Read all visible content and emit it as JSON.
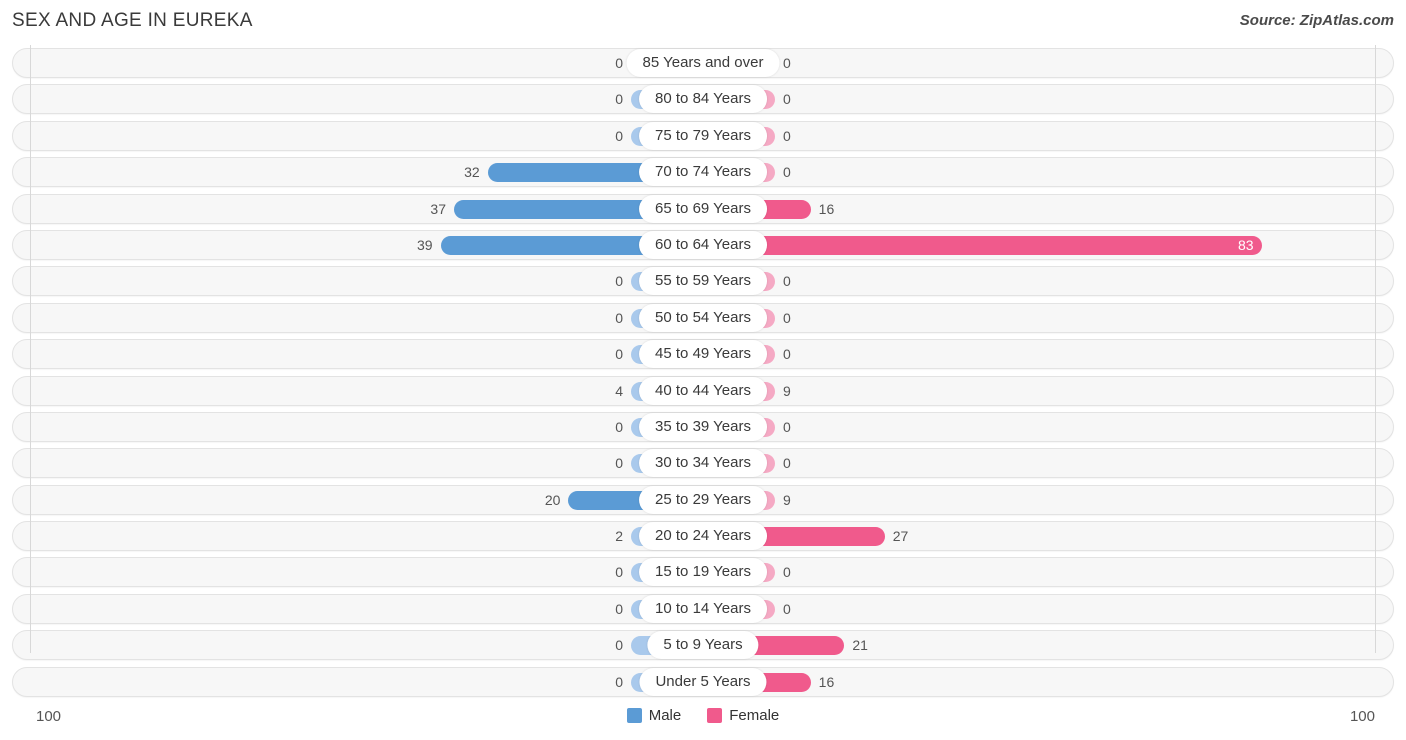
{
  "header": {
    "title": "SEX AND AGE IN EUREKA",
    "source": "Source: ZipAtlas.com"
  },
  "legend": {
    "male_label": "Male",
    "female_label": "Female",
    "male_color": "#5b9bd5",
    "female_color": "#f05a8c"
  },
  "axis": {
    "left_label": "100",
    "right_label": "100"
  },
  "chart_data": {
    "type": "bar",
    "subtype": "population-pyramid",
    "title": "SEX AND AGE IN EUREKA",
    "xlabel": "",
    "ylabel": "",
    "xlim": [
      0,
      100
    ],
    "grid": true,
    "legend_position": "bottom-center",
    "categories": [
      "85 Years and over",
      "80 to 84 Years",
      "75 to 79 Years",
      "70 to 74 Years",
      "65 to 69 Years",
      "60 to 64 Years",
      "55 to 59 Years",
      "50 to 54 Years",
      "45 to 49 Years",
      "40 to 44 Years",
      "35 to 39 Years",
      "30 to 34 Years",
      "25 to 29 Years",
      "20 to 24 Years",
      "15 to 19 Years",
      "10 to 14 Years",
      "5 to 9 Years",
      "Under 5 Years"
    ],
    "series": [
      {
        "name": "Male",
        "color": "#5b9bd5",
        "values": [
          0,
          0,
          0,
          32,
          37,
          39,
          0,
          0,
          0,
          4,
          0,
          0,
          20,
          2,
          0,
          0,
          0,
          0
        ]
      },
      {
        "name": "Female",
        "color": "#f05a8c",
        "values": [
          0,
          0,
          0,
          0,
          16,
          83,
          0,
          0,
          0,
          9,
          0,
          0,
          9,
          27,
          0,
          0,
          21,
          16
        ]
      }
    ]
  },
  "rows": [
    {
      "age": "85 Years and over",
      "male": "0",
      "female": "0"
    },
    {
      "age": "80 to 84 Years",
      "male": "0",
      "female": "0"
    },
    {
      "age": "75 to 79 Years",
      "male": "0",
      "female": "0"
    },
    {
      "age": "70 to 74 Years",
      "male": "32",
      "female": "0"
    },
    {
      "age": "65 to 69 Years",
      "male": "37",
      "female": "16"
    },
    {
      "age": "60 to 64 Years",
      "male": "39",
      "female": "83"
    },
    {
      "age": "55 to 59 Years",
      "male": "0",
      "female": "0"
    },
    {
      "age": "50 to 54 Years",
      "male": "0",
      "female": "0"
    },
    {
      "age": "45 to 49 Years",
      "male": "0",
      "female": "0"
    },
    {
      "age": "40 to 44 Years",
      "male": "4",
      "female": "9"
    },
    {
      "age": "35 to 39 Years",
      "male": "0",
      "female": "0"
    },
    {
      "age": "30 to 34 Years",
      "male": "0",
      "female": "0"
    },
    {
      "age": "25 to 29 Years",
      "male": "20",
      "female": "9"
    },
    {
      "age": "20 to 24 Years",
      "male": "2",
      "female": "27"
    },
    {
      "age": "15 to 19 Years",
      "male": "0",
      "female": "0"
    },
    {
      "age": "10 to 14 Years",
      "male": "0",
      "female": "0"
    },
    {
      "age": "5 to 9 Years",
      "male": "0",
      "female": "21"
    },
    {
      "age": "Under 5 Years",
      "male": "0",
      "female": "16"
    }
  ]
}
